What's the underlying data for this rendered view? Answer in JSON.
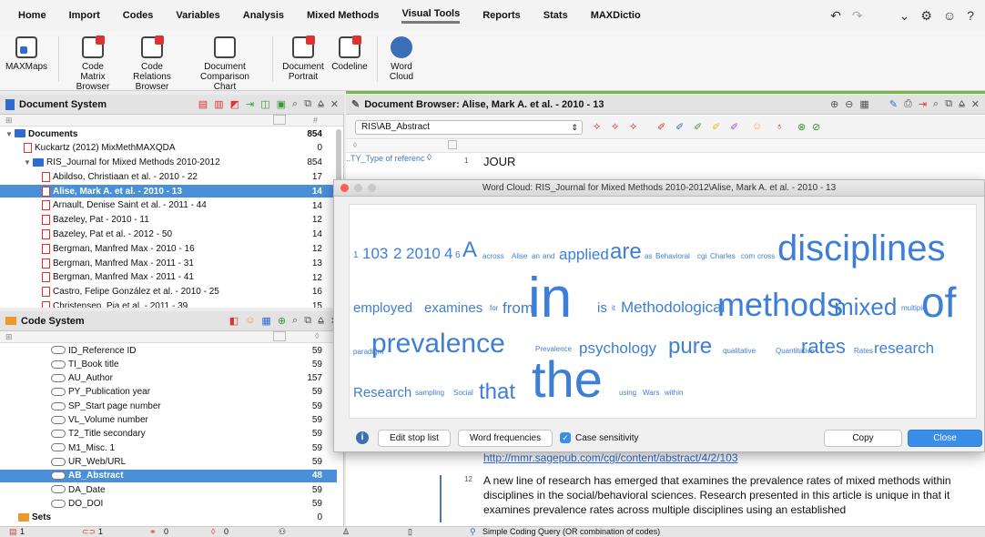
{
  "menu": {
    "items": [
      "Home",
      "Import",
      "Codes",
      "Variables",
      "Analysis",
      "Mixed Methods",
      "Visual Tools",
      "Reports",
      "Stats",
      "MAXDictio"
    ],
    "active_index": 6
  },
  "ribbon": {
    "buttons": [
      {
        "label": "MAXMaps",
        "icon": "maxmaps-icon"
      },
      {
        "label": "Code Matrix Browser",
        "icon": "code-matrix-icon"
      },
      {
        "label": "Code Relations Browser",
        "icon": "code-relations-icon"
      },
      {
        "label": "Document Comparison Chart",
        "icon": "doc-comparison-icon"
      },
      {
        "label": "Document Portrait",
        "icon": "doc-portrait-icon"
      },
      {
        "label": "Codeline",
        "icon": "codeline-icon"
      },
      {
        "label": "Word Cloud",
        "icon": "word-cloud-icon"
      }
    ]
  },
  "document_system": {
    "title": "Document System",
    "column_hash": "#",
    "rows": [
      {
        "label": "Documents",
        "count": "854",
        "level": 0,
        "type": "root"
      },
      {
        "label": "Kuckartz (2012) MixMethMAXQDA",
        "count": "0",
        "level": 1,
        "type": "doc"
      },
      {
        "label": "RIS_Journal for Mixed Methods 2010-2012",
        "count": "854",
        "level": 1,
        "type": "folder"
      },
      {
        "label": "Abildso, Christiaan et al. - 2010 - 22",
        "count": "17",
        "level": 2,
        "type": "doc"
      },
      {
        "label": "Alise, Mark A. et al. - 2010 - 13",
        "count": "14",
        "level": 2,
        "type": "doc",
        "selected": true
      },
      {
        "label": "Arnault, Denise Saint et al. - 2011 - 44",
        "count": "14",
        "level": 2,
        "type": "doc"
      },
      {
        "label": "Bazeley, Pat - 2010 - 11",
        "count": "12",
        "level": 2,
        "type": "doc"
      },
      {
        "label": "Bazeley, Pat et al. - 2012 - 50",
        "count": "14",
        "level": 2,
        "type": "doc"
      },
      {
        "label": "Bergman, Manfred Max - 2010 - 16",
        "count": "12",
        "level": 2,
        "type": "doc"
      },
      {
        "label": "Bergman, Manfred Max - 2011 - 31",
        "count": "13",
        "level": 2,
        "type": "doc"
      },
      {
        "label": "Bergman, Manfred Max - 2011 - 41",
        "count": "12",
        "level": 2,
        "type": "doc"
      },
      {
        "label": "Castro, Felipe González et al. - 2010 - 25",
        "count": "16",
        "level": 2,
        "type": "doc"
      },
      {
        "label": "Christensen, Pia et al. - 2011 - 39",
        "count": "15",
        "level": 2,
        "type": "doc"
      }
    ]
  },
  "code_system": {
    "title": "Code System",
    "rows": [
      {
        "label": "ID_Reference ID",
        "count": "59"
      },
      {
        "label": "TI_Book title",
        "count": "59"
      },
      {
        "label": "AU_Author",
        "count": "157"
      },
      {
        "label": "PY_Publication year",
        "count": "59"
      },
      {
        "label": "SP_Start page number",
        "count": "59"
      },
      {
        "label": "VL_Volume number",
        "count": "59"
      },
      {
        "label": "T2_Title secondary",
        "count": "59"
      },
      {
        "label": "M1_Misc. 1",
        "count": "59"
      },
      {
        "label": "UR_Web/URL",
        "count": "59"
      },
      {
        "label": "AB_Abstract",
        "count": "48",
        "selected": true
      },
      {
        "label": "DA_Date",
        "count": "59"
      },
      {
        "label": "DO_DOI",
        "count": "59"
      },
      {
        "label": "Sets",
        "count": "0",
        "type": "sets"
      }
    ]
  },
  "browser": {
    "title": "Document Browser: Alise, Mark A. et al. - 2010 - 13",
    "selected_code": "RIS\\AB_Abstract",
    "lines": [
      {
        "code": "..TY_Type of referenc",
        "num": "1",
        "text": "JOUR"
      },
      {
        "num": "",
        "text": "http://mmr.sagepub.com/cgi/content/abstract/4/2/103"
      },
      {
        "num": "12",
        "text": "A new line of research has emerged that examines the prevalence rates of mixed methods within disciplines in the social/behavioral sciences. Research presented in this article is unique in that it examines prevalence rates across multiple disciplines using an established"
      }
    ]
  },
  "word_cloud": {
    "title": "Word Cloud: RIS_Journal for Mixed Methods 2010-2012\\Alise, Mark A. et al. - 2010 - 13",
    "words": [
      "1",
      "103",
      "2",
      "2010",
      "4",
      "6",
      "A",
      "across",
      "Alise",
      "an",
      "and",
      "applied",
      "are",
      "as",
      "Behavioral",
      "cgi",
      "Charles",
      "com",
      "cross",
      "disciplines",
      "employed",
      "examines",
      "for",
      "from",
      "in",
      "is",
      "it",
      "Methodological",
      "methods",
      "mixed",
      "multiple",
      "of",
      "paradigm",
      "prevalence",
      "Prevalence",
      "psychology",
      "pure",
      "qualitative",
      "Quantitative",
      "rates",
      "Rates",
      "research",
      "Research",
      "sampling",
      "Social",
      "that",
      "the",
      "using",
      "Wars",
      "within"
    ],
    "buttons": {
      "edit_stop_list": "Edit stop list",
      "word_frequencies": "Word frequencies",
      "case_sensitivity": "Case sensitivity",
      "copy": "Copy",
      "close": "Close"
    }
  },
  "status_bar": {
    "items": [
      "1",
      "1",
      "0",
      "0"
    ],
    "query": "Simple Coding Query (OR combination of codes)"
  },
  "colors": {
    "accent_blue": "#3d7fd6",
    "selection": "#4a90d9",
    "green_line": "#7ab648"
  }
}
